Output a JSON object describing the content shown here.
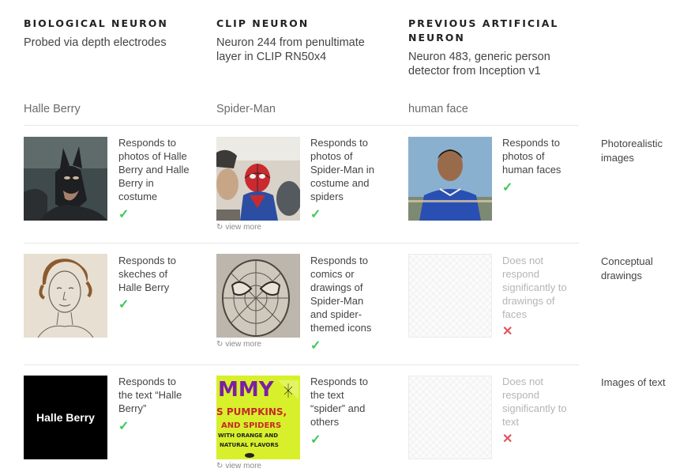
{
  "columns": [
    {
      "title": "BIOLOGICAL NEURON",
      "desc_lines": [
        "Probed via depth electrodes"
      ],
      "label": "Halle Berry"
    },
    {
      "title": "CLIP NEURON",
      "desc_lines": [
        "Neuron 244 from penultimate",
        "layer in CLIP RN50x4"
      ],
      "label": "Spider-Man"
    },
    {
      "title_lines": [
        "PREVIOUS ARTIFICIAL",
        "NEURON"
      ],
      "desc_lines": [
        "Neuron 483, generic person",
        "detector from Inception v1"
      ],
      "label": "human face"
    }
  ],
  "rows": [
    {
      "label_lines": [
        "Photorealistic",
        "images"
      ],
      "cells": [
        {
          "text_lines": [
            "Responds to",
            "photos of Halle",
            "Berry and Halle",
            "Berry in",
            "costume"
          ],
          "status": "check",
          "image": "catwoman-photo"
        },
        {
          "text_lines": [
            "Responds to",
            "photos of",
            "Spider-Man in",
            "costume and",
            "spiders"
          ],
          "status": "check",
          "image": "spiderman-photo",
          "view_more": "view more"
        },
        {
          "text_lines": [
            "Responds to",
            "photos of",
            "human faces"
          ],
          "status": "check",
          "image": "face-photo"
        }
      ]
    },
    {
      "label_lines": [
        "Conceptual",
        "drawings"
      ],
      "cells": [
        {
          "text_lines": [
            "Responds to",
            "skeches of",
            "Halle Berry"
          ],
          "status": "check",
          "image": "halle-sketch"
        },
        {
          "text_lines": [
            "Responds to",
            "comics or",
            "drawings of",
            "Spider-Man",
            "and spider-",
            "themed icons"
          ],
          "status": "check",
          "image": "spiderman-sketch",
          "view_more": "view more"
        },
        {
          "text_lines": [
            "Does not",
            "respond",
            "significantly to",
            "drawings of",
            "faces"
          ],
          "status": "cross",
          "image": "blank"
        }
      ]
    },
    {
      "label_lines": [
        "Images of text"
      ],
      "cells": [
        {
          "text_lines": [
            "Responds to",
            "the text “Halle",
            "Berry”"
          ],
          "status": "check",
          "image": "halle-text",
          "image_text": "Halle Berry"
        },
        {
          "text_lines": [
            "Responds to",
            "the text",
            "“spider” and",
            "others"
          ],
          "status": "check",
          "image": "spider-text-poster",
          "view_more": "view more",
          "poster_lines": [
            "MMY",
            "S PUMPKINS,",
            "AND SPIDERS",
            "WITH ORANGE AND",
            "NATURAL FLAVORS"
          ]
        },
        {
          "text_lines": [
            "Does not",
            "respond",
            "significantly to",
            "text"
          ],
          "status": "cross",
          "image": "blank"
        }
      ]
    }
  ],
  "marks": {
    "check": "✓",
    "cross": "✕"
  },
  "view_more_icon": "↻",
  "colors": {
    "check": "#3cc85a",
    "cross": "#e0565b",
    "divider": "#e6e6e6"
  }
}
